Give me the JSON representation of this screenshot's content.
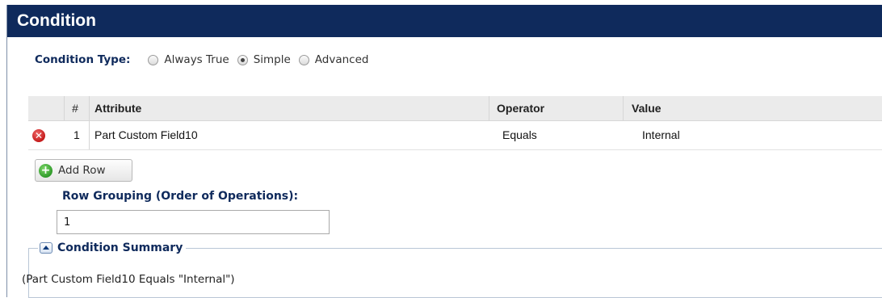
{
  "panel": {
    "title": "Condition"
  },
  "condition_type": {
    "label": "Condition Type:",
    "options": [
      {
        "label": "Always True",
        "selected": false
      },
      {
        "label": "Simple",
        "selected": true
      },
      {
        "label": "Advanced",
        "selected": false
      }
    ]
  },
  "grid": {
    "columns": {
      "num": "#",
      "attribute": "Attribute",
      "operator": "Operator",
      "value": "Value"
    },
    "rows": [
      {
        "num": "1",
        "attribute": "Part Custom Field10",
        "operator": "Equals",
        "value": "Internal"
      }
    ]
  },
  "add_row": {
    "label": "Add Row"
  },
  "row_grouping": {
    "label": "Row Grouping (Order of Operations):",
    "value": "1"
  },
  "summary": {
    "legend": "Condition Summary",
    "text": "(Part Custom Field10 Equals \"Internal\")"
  },
  "colors": {
    "header_bg": "#0f2a5c",
    "label_blue": "#0f2a5c",
    "delete_red": "#c41a1a",
    "add_green": "#2f9a2a"
  },
  "icons": {
    "delete": "delete-icon",
    "add": "add-icon",
    "collapse": "collapse-icon"
  }
}
